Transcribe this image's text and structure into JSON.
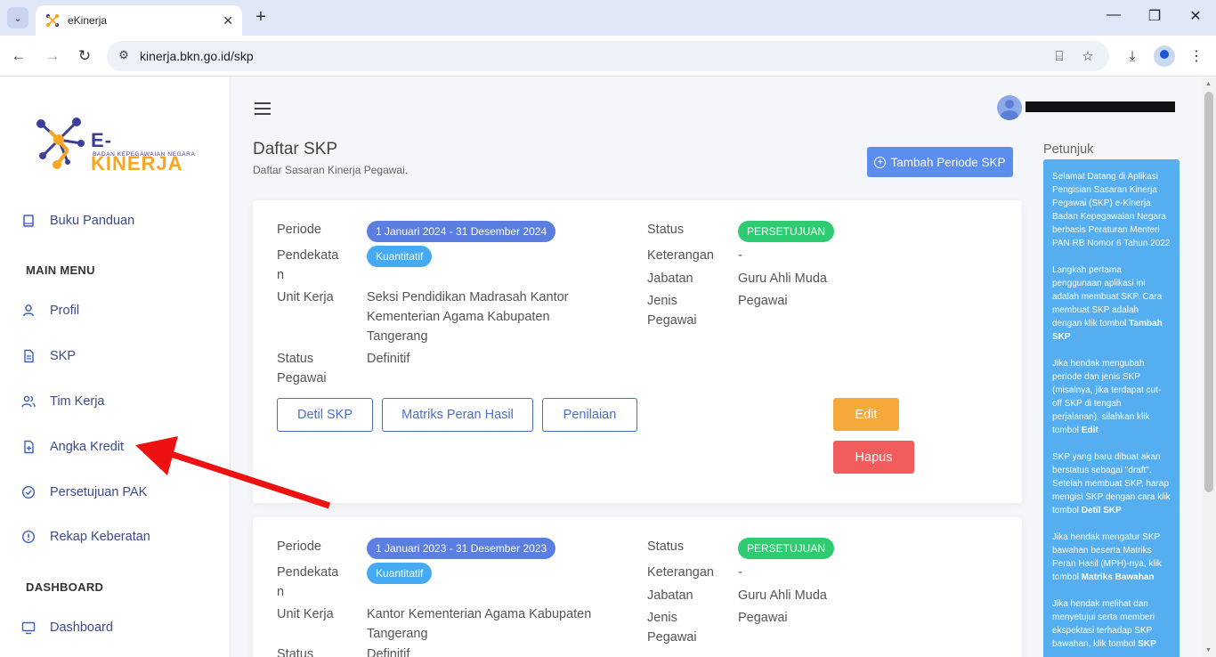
{
  "browser": {
    "tab_title": "eKinerja",
    "url": "kinerja.bkn.go.id/skp"
  },
  "sidebar": {
    "logo_text": "E-KINERJA",
    "logo_sub": "BADAN KEPEGAWAIAN NEGARA",
    "top_item": {
      "label": "Buku Panduan",
      "icon": "book-icon"
    },
    "main_menu_heading": "MAIN MENU",
    "items": [
      {
        "label": "Profil",
        "icon": "user-icon"
      },
      {
        "label": "SKP",
        "icon": "document-icon"
      },
      {
        "label": "Tim Kerja",
        "icon": "users-icon"
      },
      {
        "label": "Angka Kredit",
        "icon": "file-plus-icon"
      },
      {
        "label": "Persetujuan PAK",
        "icon": "check-circle-icon"
      },
      {
        "label": "Rekap Keberatan",
        "icon": "alert-circle-icon"
      }
    ],
    "dashboard_heading": "DASHBOARD",
    "dashboard_item": {
      "label": "Dashboard",
      "icon": "monitor-icon"
    }
  },
  "header": {
    "page_title": "Daftar SKP",
    "page_subtitle": "Daftar Sasaran Kinerja Pegawai.",
    "add_button": "Tambah Periode SKP"
  },
  "labels": {
    "periode": "Periode",
    "pendekatan": "Pendekata",
    "pendekatan2": "n",
    "unit_kerja": "Unit Kerja",
    "status_pegawai": "Status",
    "status_pegawai2": "Pegawai",
    "status": "Status",
    "keterangan": "Keterangan",
    "jabatan": "Jabatan",
    "jenis_pegawai": "Jenis",
    "jenis_pegawai2": "Pegawai"
  },
  "buttons": {
    "detil": "Detil SKP",
    "matriks": "Matriks Peran Hasil",
    "penilaian": "Penilaian",
    "edit": "Edit",
    "hapus": "Hapus"
  },
  "cards": [
    {
      "periode": "1 Januari 2024 - 31 Desember 2024",
      "pendekatan": "Kuantitatif",
      "unit_kerja": [
        "Seksi Pendidikan Madrasah Kantor",
        "Kementerian Agama Kabupaten",
        "Tangerang"
      ],
      "status_pegawai": "Definitif",
      "status": "PERSETUJUAN",
      "keterangan": "-",
      "jabatan": "Guru Ahli Muda",
      "jenis_pegawai": "Pegawai"
    },
    {
      "periode": "1 Januari 2023 - 31 Desember 2023",
      "pendekatan": "Kuantitatif",
      "unit_kerja": [
        "Kantor Kementerian Agama Kabupaten",
        "Tangerang"
      ],
      "status_pegawai": "Definitif",
      "status": "PERSETUJUAN",
      "keterangan": "-",
      "jabatan": "Guru Ahli Muda",
      "jenis_pegawai": "Pegawai"
    }
  ],
  "petunjuk": {
    "title": "Petunjuk",
    "p1": "Selamat Datang di Aplikasi Pengisian Sasaran Kinerja Pegawai (SKP) e-Kinerja Badan Kepegawaian Negara berbasis Peraturan Menteri PAN RB Nomor 6 Tahun 2022",
    "p2": "Langkah pertama penggunaan aplikasi ini adalah membuat SKP. Cara membuat SKP adalah dengan klik tombol ",
    "p2b": "Tambah SKP",
    "p3": "Jika hendak mengubah periode dan jenis SKP (misalnya, jika terdapat cut-off SKP di tengah perjalanan), silahkan klik tombol ",
    "p3b": "Edit",
    "p4": "SKP yang baru dibuat akan berstatus sebagai \"draft\". Setelah membuat SKP, harap mengisi SKP dengan cara klik tombol ",
    "p4b": "Detil SKP",
    "p5": "Jika hendak mengatur SKP bawahan beserta Matriks Peran Hasil (MPH)-nya, klik tombol ",
    "p5b": "Matriks Bawahan",
    "p6": "Jika hendak melihat dan menyetujui serta memberi ekspektasi terhadap SKP bawahan, klik tombol ",
    "p6b": "SKP"
  },
  "colors": {
    "primary": "#5b8def",
    "edit": "#f6a93b",
    "hapus": "#f25c5c",
    "status_green": "#2ecc71",
    "arrow": "#ee1111"
  }
}
